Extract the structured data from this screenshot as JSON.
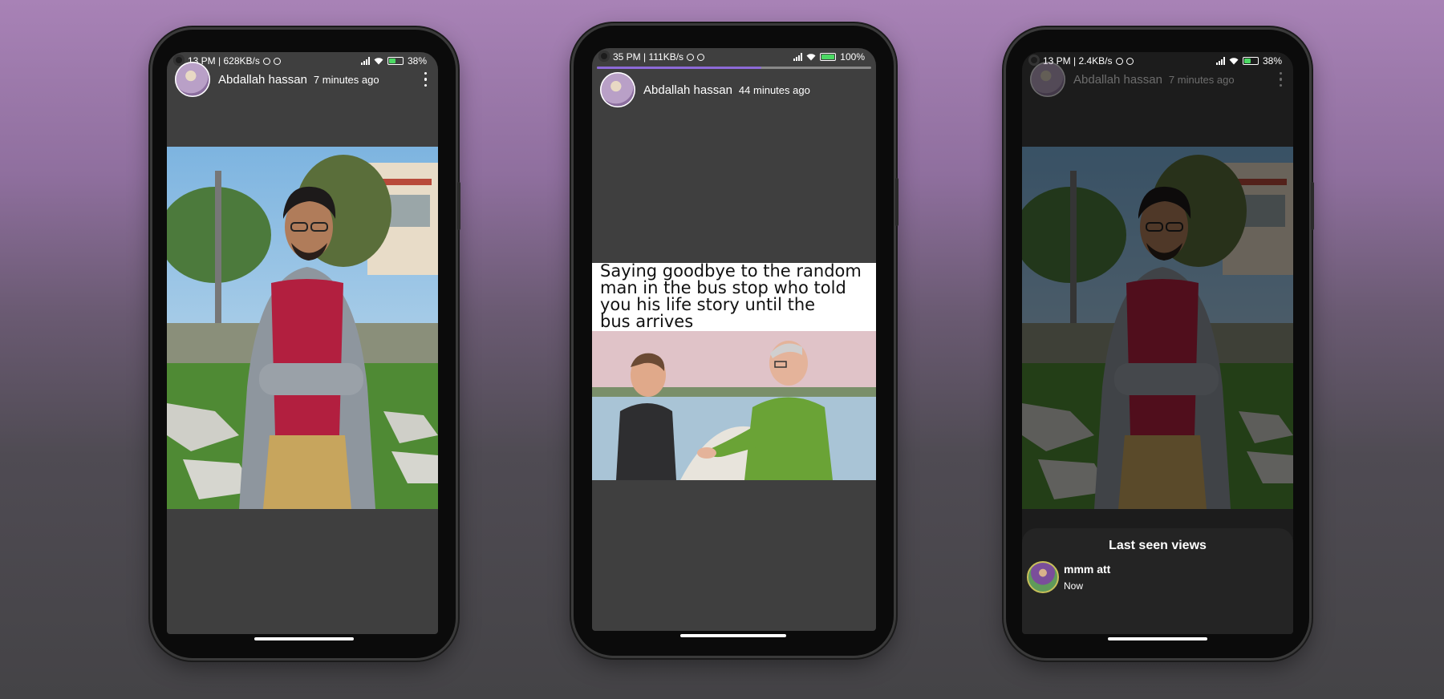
{
  "colors": {
    "screen_bg": "#3f3f3f",
    "progress_fill": "#8d6ad8",
    "sheet_bg": "#242424",
    "battery_green": "#4cd964"
  },
  "phones": [
    {
      "status": {
        "time": "13 PM | 628KB/s",
        "battery": "38%"
      },
      "story": {
        "username": "Abdallah hassan",
        "time_ago": "7 minutes ago",
        "menu_icon": "more-vertical-icon"
      }
    },
    {
      "status": {
        "time": "35 PM | 111KB/s",
        "battery": "100%"
      },
      "story": {
        "username": "Abdallah hassan",
        "time_ago": "44 minutes ago",
        "progress": 0.6,
        "caption_lines": [
          "Saying goodbye to the random",
          "man in the bus stop who told",
          "you his life story until the",
          "bus arrives"
        ]
      }
    },
    {
      "status": {
        "time": "13 PM | 2.4KB/s",
        "battery": "38%"
      },
      "story": {
        "username": "Abdallah hassan",
        "time_ago": "7 minutes ago",
        "menu_icon": "more-vertical-icon"
      },
      "views_sheet": {
        "title": "Last seen views",
        "viewers": [
          {
            "name": "mmm att",
            "time": "Now"
          }
        ]
      }
    }
  ]
}
